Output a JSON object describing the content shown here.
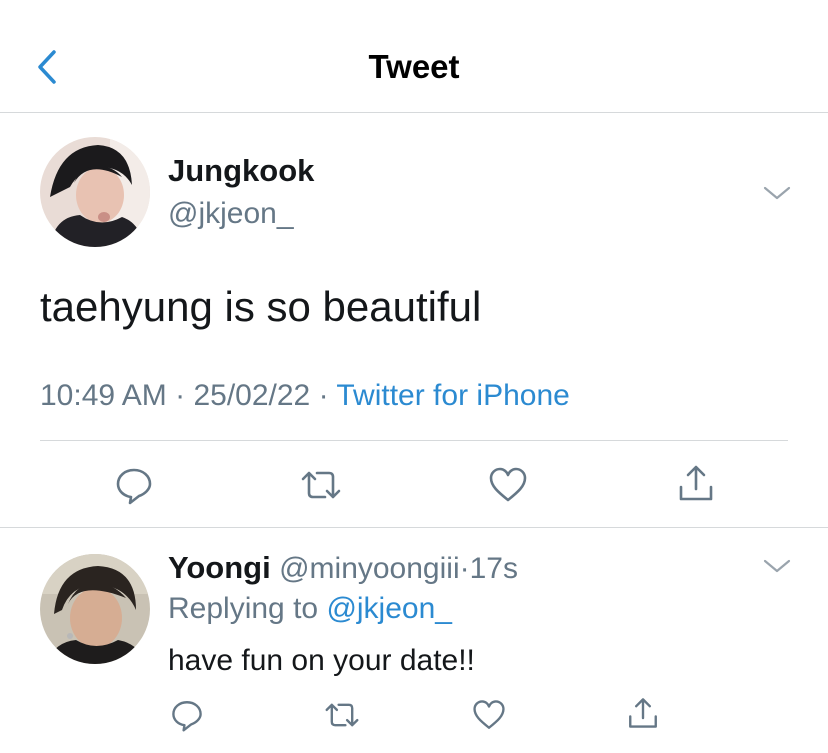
{
  "header": {
    "title": "Tweet",
    "back_icon": "chevron-left-icon"
  },
  "tweet": {
    "author_name": "Jungkook",
    "author_handle": "@jkjeon_",
    "text": "taehyung is so beautiful",
    "time": "10:49 AM",
    "date": "25/02/22",
    "separator": "·",
    "source": "Twitter for iPhone",
    "actions": [
      "comment-icon",
      "retweet-icon",
      "like-icon",
      "share-icon"
    ]
  },
  "reply": {
    "author_name": "Yoongi",
    "author_handle": "@minyoongiii",
    "separator": "·",
    "age": "17s",
    "replying_to_label": "Replying to",
    "replying_to_handle": "@jkjeon_",
    "text": "have fun on your date!!",
    "actions": [
      "comment-icon",
      "retweet-icon",
      "like-icon",
      "share-icon"
    ]
  },
  "colors": {
    "accent": "#2b8ad1",
    "muted_text": "#657786",
    "primary_text": "#14171a",
    "divider": "#d6d9db"
  }
}
